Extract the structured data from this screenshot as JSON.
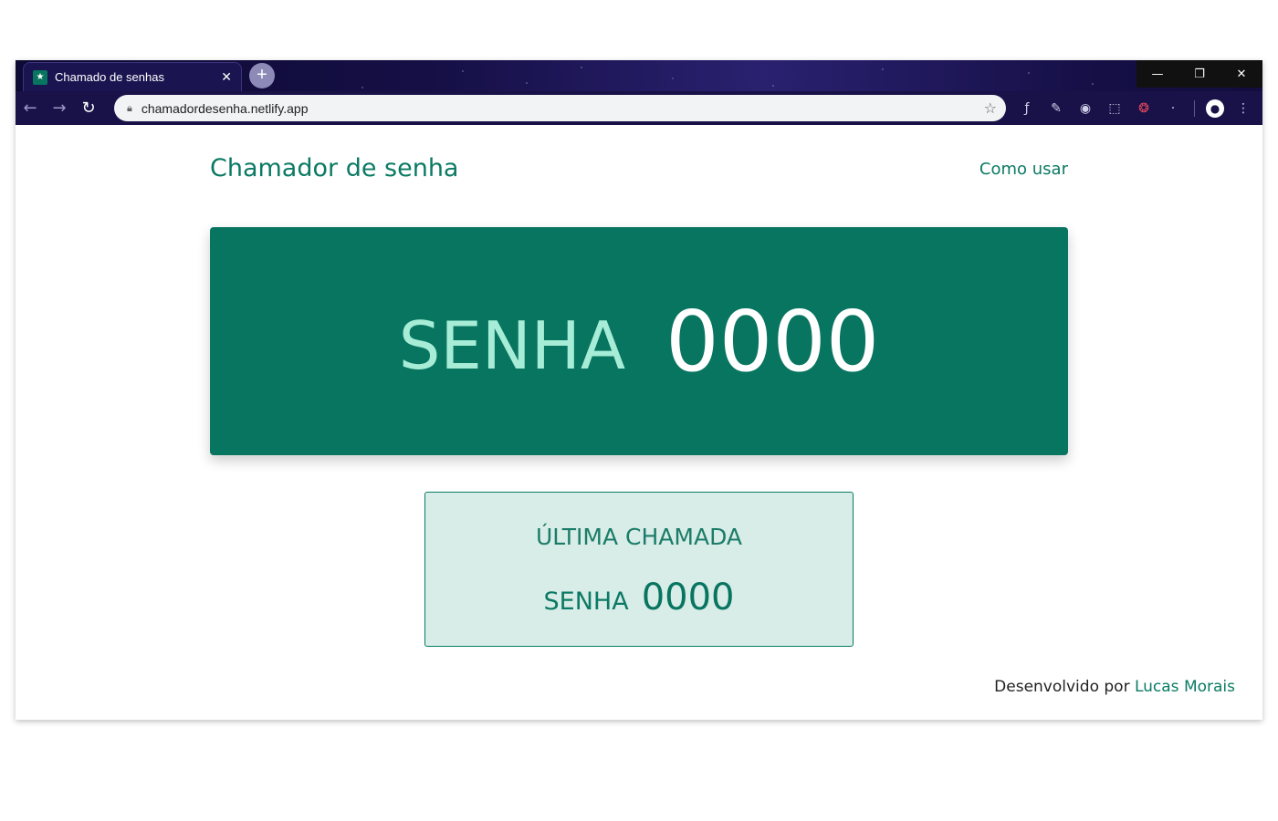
{
  "browser": {
    "tab_title": "Chamado de senhas",
    "tab_close": "✕",
    "new_tab": "+",
    "url": "chamadordesenha.netlify.app",
    "window_controls": {
      "minimize": "—",
      "restore": "❐",
      "close": "✕"
    }
  },
  "header": {
    "title": "Chamador de senha",
    "how_to_link": "Como usar"
  },
  "current_call": {
    "label": "SENHA",
    "number": "0000"
  },
  "last_call": {
    "title": "ÚLTIMA CHAMADA",
    "label": "SENHA",
    "number": "0000"
  },
  "footer": {
    "prefix": "Desenvolvido por",
    "author": "Lucas Morais"
  },
  "colors": {
    "brand": "#07755f",
    "main_label": "#a7ecd6",
    "last_card_bg": "#d8ece8",
    "titlebar": "#150f45"
  }
}
